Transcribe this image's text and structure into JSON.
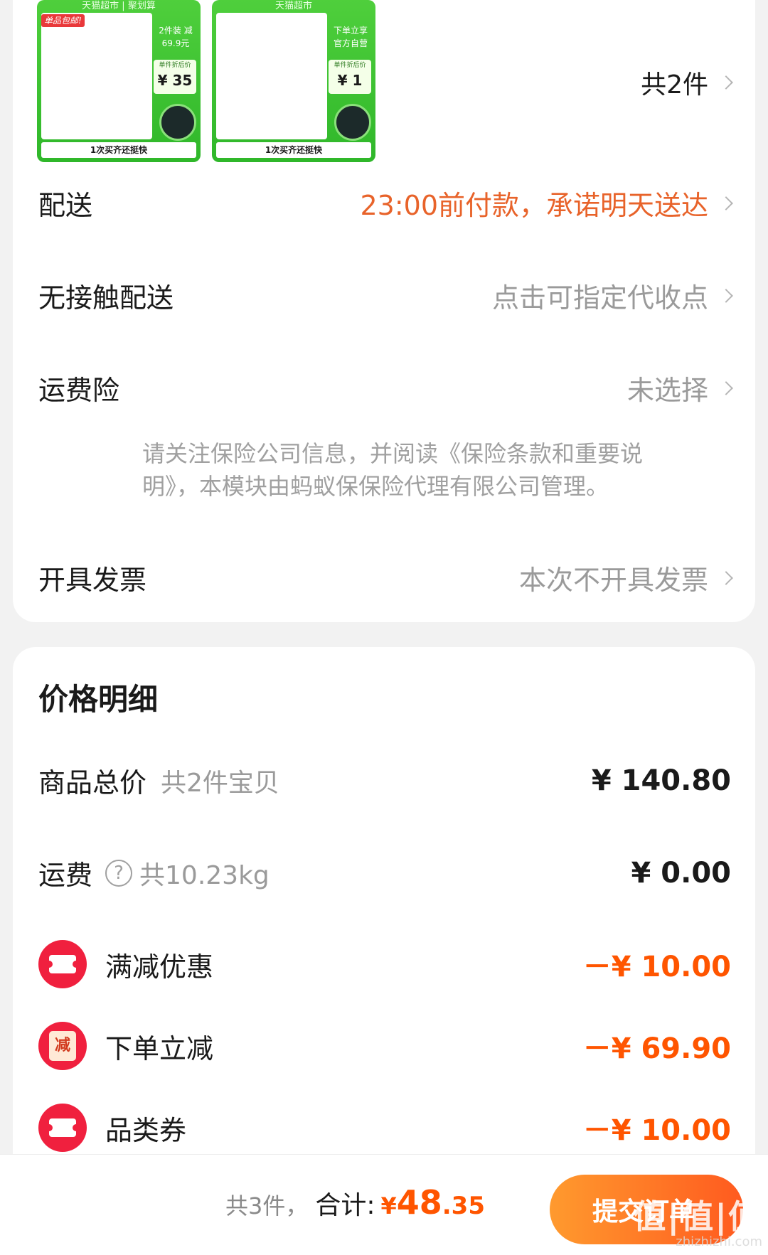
{
  "order": {
    "products": [
      {
        "header": "天猫超市 | 聚划算",
        "badge": "单品包邮!",
        "tag": "2件装 减69.9元",
        "price_label": "单件折后价",
        "price": "¥ 35",
        "footer": "1次买齐还挺快"
      },
      {
        "header": "天猫超市",
        "badge": "",
        "tag": "下单立享 官方自营",
        "price_label": "单件折后价",
        "price": "¥ 1",
        "footer": "1次买齐还挺快"
      }
    ],
    "item_count": "共2件",
    "rows": {
      "delivery": {
        "label": "配送",
        "value": "23:00前付款，承诺明天送达"
      },
      "contactless": {
        "label": "无接触配送",
        "value": "点击可指定代收点"
      },
      "shipping_insurance": {
        "label": "运费险",
        "value": "未选择"
      },
      "invoice": {
        "label": "开具发票",
        "value": "本次不开具发票"
      }
    },
    "insurance_note": "请关注保险公司信息，并阅读《保险条款和重要说明》，本模块由蚂蚁保保险代理有限公司管理。"
  },
  "price_detail": {
    "title": "价格明细",
    "goods_total": {
      "label": "商品总价",
      "sub": "共2件宝贝",
      "amount": "¥ 140.80"
    },
    "freight": {
      "label": "运费",
      "help": "?",
      "sub": "共10.23kg",
      "amount": "¥ 0.00"
    },
    "discounts": [
      {
        "label": "满减优惠",
        "amount": "－¥ 10.00",
        "icon": "ticket-icon"
      },
      {
        "label": "下单立减",
        "amount": "－¥ 69.90",
        "icon": "instant-reduce-icon",
        "icon_text": "减"
      },
      {
        "label": "品类券",
        "amount": "－¥ 10.00",
        "icon": "ticket-icon"
      }
    ]
  },
  "bottom_bar": {
    "count": "共3件，",
    "total_label": "合计:",
    "currency": "¥",
    "total_int": "48",
    "total_dec": ".35",
    "submit_label": "提交订单",
    "watermark": "值|值|值",
    "watermark_url": "zhizhizhi.com"
  },
  "colors": {
    "accent_orange": "#e8632a",
    "price_red": "#ff5500",
    "discount_icon_red": "#f0203e",
    "submit_gradient_start": "#ff9a2e",
    "submit_gradient_end": "#ff5a1f",
    "product_green": "#2fb72a"
  }
}
